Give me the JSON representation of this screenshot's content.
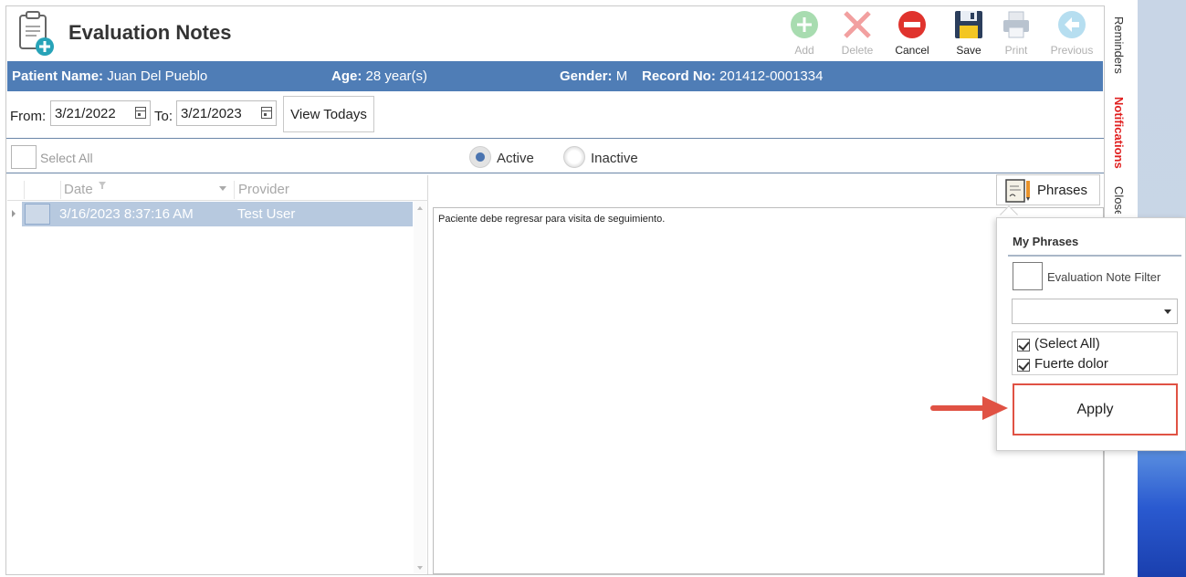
{
  "app": {
    "title": "Evaluation Notes"
  },
  "toolbar": {
    "add": "Add",
    "delete": "Delete",
    "cancel": "Cancel",
    "save": "Save",
    "print": "Print",
    "previous": "Previous"
  },
  "patient": {
    "name_label": "Patient Name:",
    "name": "Juan Del Pueblo",
    "age_label": "Age:",
    "age": "28 year(s)",
    "gender_label": "Gender:",
    "gender": "M",
    "record_label": "Record No:",
    "record": "201412-0001334"
  },
  "filter": {
    "from_label": "From:",
    "from_value": "3/21/2022",
    "to_label": "To:",
    "to_value": "3/21/2023",
    "view_todays": "View Todays"
  },
  "status": {
    "select_all": "Select All",
    "active": "Active",
    "inactive": "Inactive",
    "selected": "Active"
  },
  "grid": {
    "columns": [
      "Date",
      "Provider"
    ],
    "rows": [
      {
        "date": "3/16/2023 8:37:16 AM",
        "provider": "Test User"
      }
    ]
  },
  "note": {
    "phrases_button": "Phrases",
    "text": "Paciente debe regresar para visita de seguimiento."
  },
  "popup": {
    "title": "My Phrases",
    "filter_label": "Evaluation Note Filter",
    "combo_value": "",
    "items": [
      {
        "label": "(Select All)",
        "checked": true
      },
      {
        "label": "Fuerte dolor",
        "checked": true
      }
    ],
    "apply": "Apply"
  },
  "sidebar": {
    "reminders": "Reminders",
    "notifications": "Notifications",
    "close": "Close"
  },
  "colors": {
    "header_bar": "#4f7db6",
    "selected_row": "#b7c9df",
    "accent_red": "#e05244",
    "notifications_red": "#e02020"
  }
}
